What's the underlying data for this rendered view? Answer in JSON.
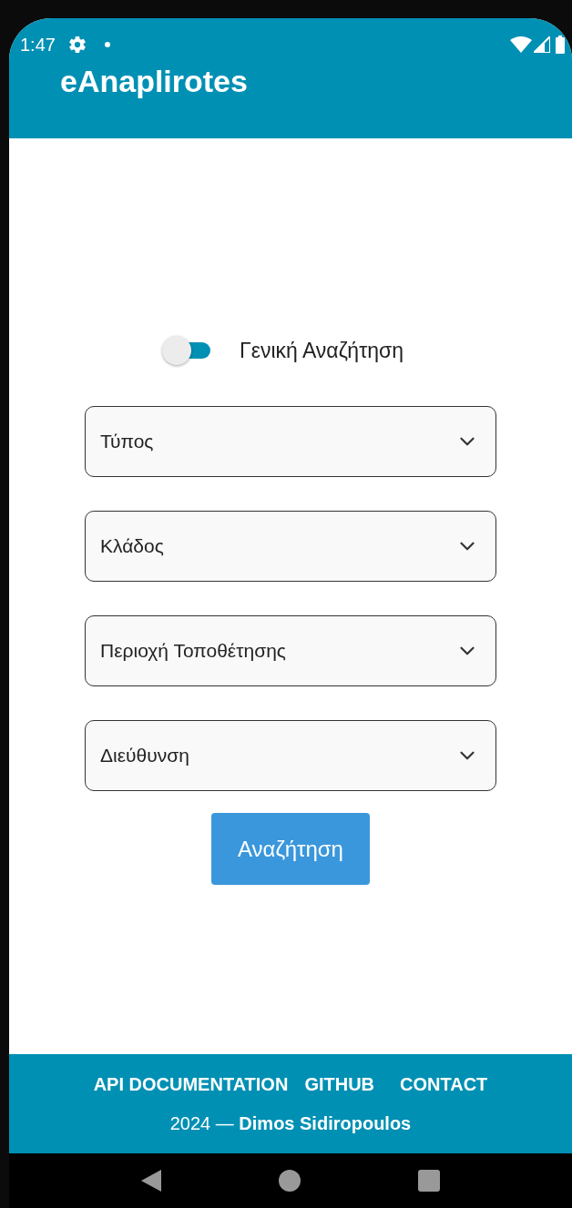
{
  "status_bar": {
    "time": "1:47"
  },
  "app_bar": {
    "title": "eAnaplirotes"
  },
  "general_search": {
    "label": "Γενική Αναζήτηση",
    "on": false
  },
  "dropdowns": [
    {
      "placeholder": "Τύπος"
    },
    {
      "placeholder": "Κλάδος"
    },
    {
      "placeholder": "Περιοχή Τοποθέτησης"
    },
    {
      "placeholder": "Διεύθυνση"
    }
  ],
  "search_button": "Αναζήτηση",
  "footer": {
    "links": [
      "API DOCUMENTATION",
      "GITHUB",
      "CONTACT"
    ],
    "credit": "2024 — **Dimos Sidiropoulos**"
  }
}
